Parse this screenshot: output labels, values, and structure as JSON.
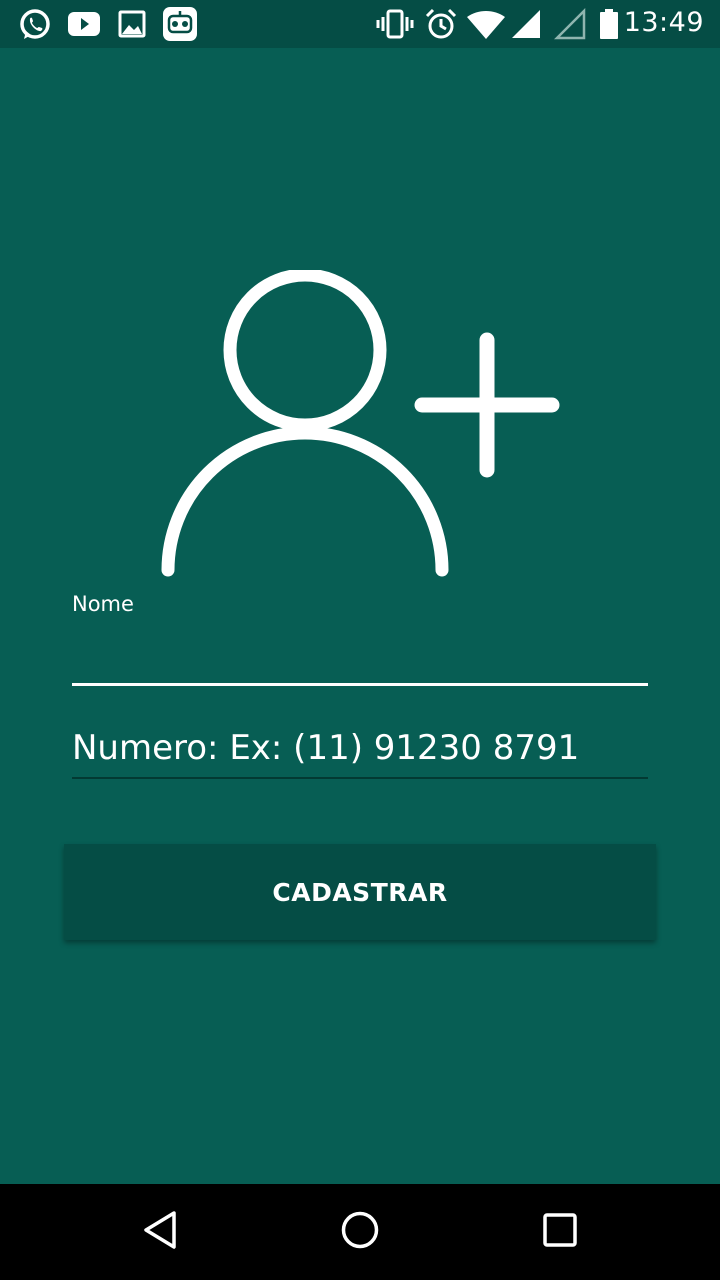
{
  "status_bar": {
    "time": "13:49",
    "left_icons": [
      "whatsapp-icon",
      "youtube-icon",
      "gallery-icon",
      "bot-app-icon"
    ],
    "right_icons": [
      "vibrate-icon",
      "alarm-icon",
      "wifi-icon",
      "signal-icon",
      "signal-empty-icon",
      "battery-icon"
    ]
  },
  "form": {
    "avatar_icon": "add-contact-icon",
    "nome_label": "Nome",
    "nome_value": "",
    "numero_placeholder": "Numero: Ex: (11) 91230 8791",
    "numero_value": "",
    "submit_label": "CADASTRAR"
  },
  "nav_bar": {
    "buttons": [
      "back-icon",
      "home-icon",
      "recents-icon"
    ]
  },
  "colors": {
    "background": "#075E54",
    "status_bar": "#054D45",
    "button": "#054D45",
    "text": "#FFFFFF",
    "nav_bar": "#000000"
  }
}
